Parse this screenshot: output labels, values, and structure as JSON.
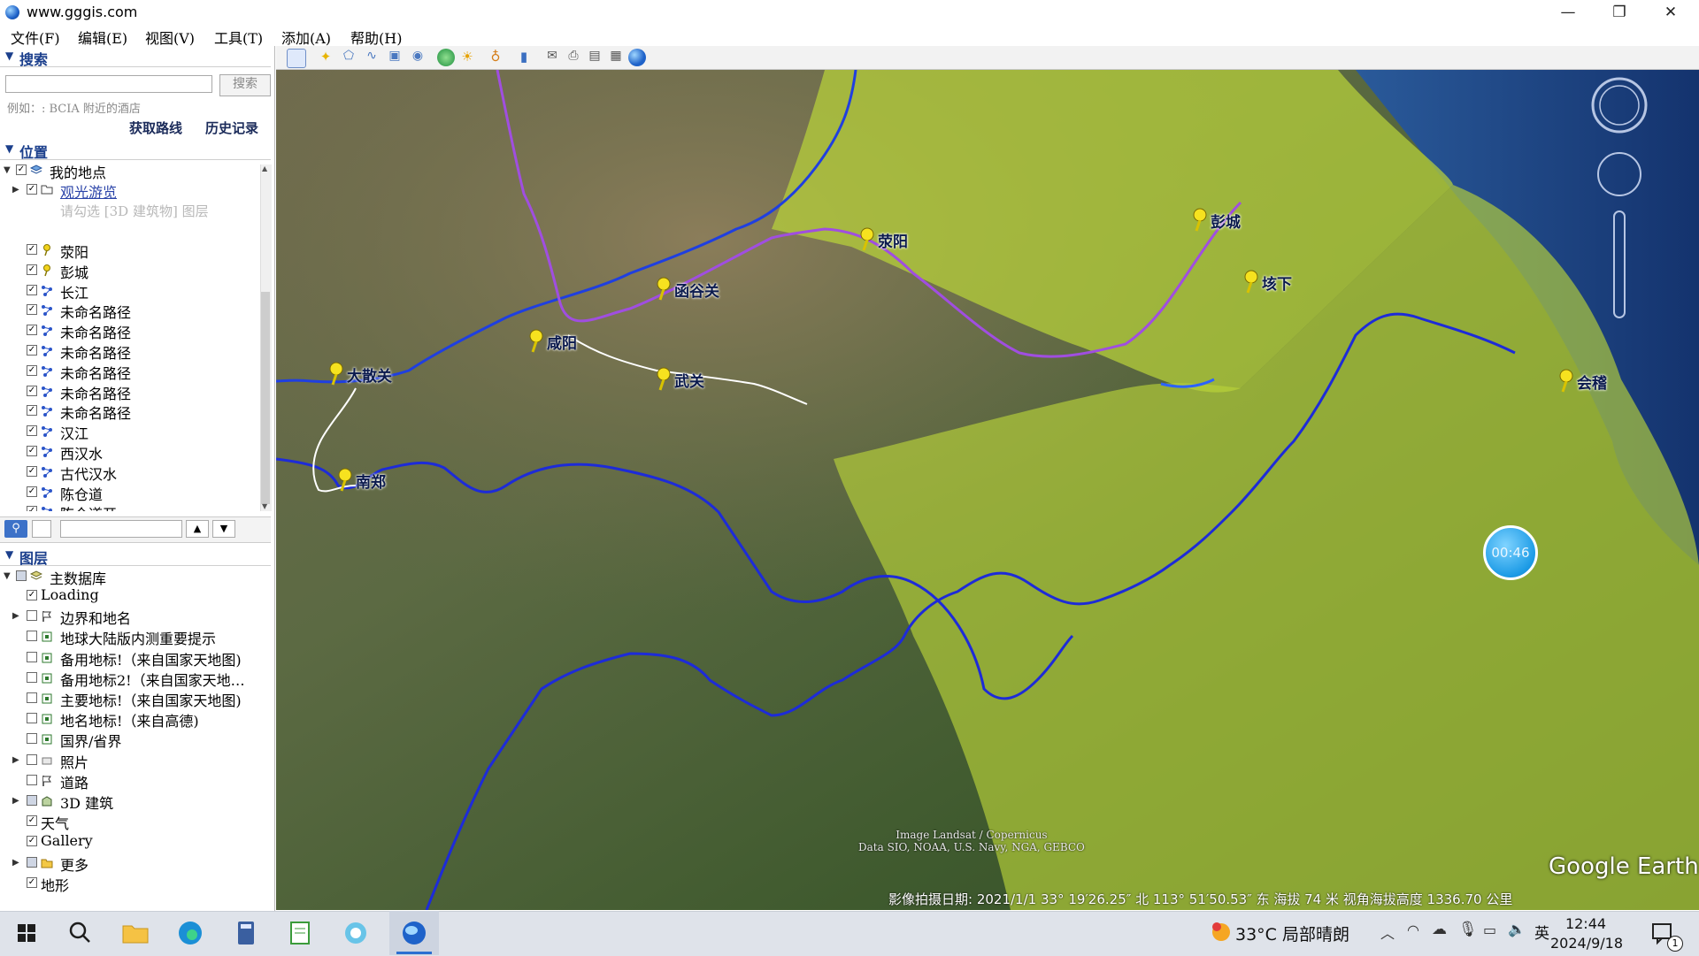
{
  "window": {
    "title": "www.gggis.com",
    "minimize": "—",
    "restore": "❐",
    "close": "✕"
  },
  "menu": [
    "文件(F)",
    "编辑(E)",
    "视图(V)",
    "工具(T)",
    "添加(A)",
    "帮助(H)"
  ],
  "search": {
    "header": "搜索",
    "input_value": "",
    "button": "搜索",
    "hint": "例如：: BCIA 附近的酒店",
    "get_route": "获取路线",
    "history": "历史记录"
  },
  "places": {
    "header": "位置",
    "root": "我的地点",
    "tour_folder": "观光游览",
    "tour_hint": "请勾选 [3D 建筑物] 图层",
    "items": [
      "荥阳",
      "彭城",
      "长江",
      "未命名路径",
      "未命名路径",
      "未命名路径",
      "未命名路径",
      "未命名路径",
      "未命名路径",
      "汉江",
      "西汉水",
      "古代汉水",
      "陈仓道",
      "陈仓道开..."
    ]
  },
  "layers": {
    "header": "图层",
    "root": "主数据库",
    "items": [
      "Loading",
      "边界和地名",
      "地球大陆版内测重要提示",
      "备用地标!（来自国家天地图)",
      "备用地标2!（来自国家天地…",
      "主要地标!（来自国家天地图)",
      "地名地标!（来自高德)",
      "国界/省界",
      "照片",
      "道路",
      "3D 建筑",
      "天气",
      "Gallery",
      "更多",
      "地形"
    ]
  },
  "map": {
    "labels": [
      "荥阳",
      "彭城",
      "垓下",
      "函谷关",
      "咸阳",
      "大散关",
      "武关",
      "会稽",
      "南郑"
    ],
    "attribution_1": "Image Landsat / Copernicus",
    "attribution_2": "Data SIO, NOAA, U.S. Navy, NGA, GEBCO",
    "logo": "Google Earth",
    "timer": "00:46",
    "status": "影像拍摄日期: 2021/1/1    33° 19′26.25″ 北 113° 51′50.53″ 东 海拔    74 米    视角海拔高度 1336.70 公里"
  },
  "taskbar": {
    "weather": "33°C 局部晴朗",
    "ime": "英",
    "time": "12:44",
    "date": "2024/9/18",
    "notifications": "1"
  }
}
